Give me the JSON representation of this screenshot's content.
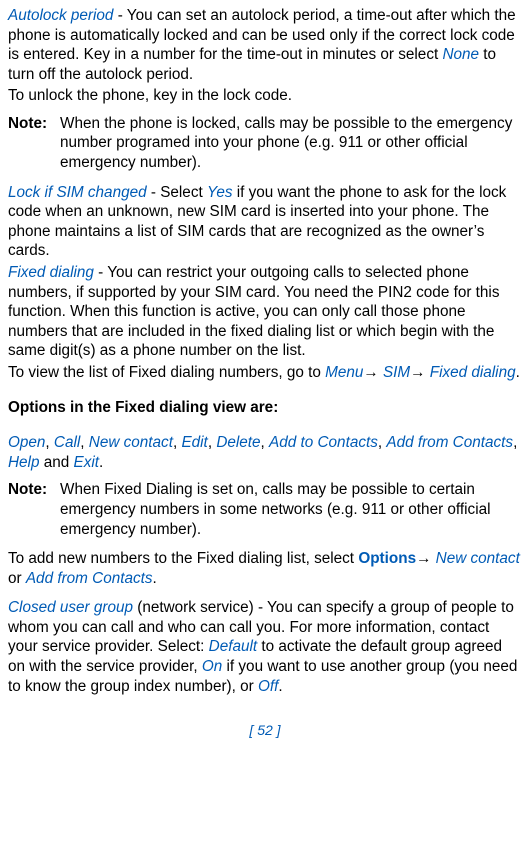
{
  "p1": {
    "t1": "Autolock period",
    "t2": " - You can set an autolock period, a time-out after which the phone is automatically locked and can be used only if the correct lock code is entered. Key in a number for the time-out in minutes or select ",
    "t3": "None",
    "t4": " to turn off the autolock period."
  },
  "p2": "To unlock the phone, key in the lock code.",
  "note1": {
    "label": "Note:",
    "body": "When the phone is locked, calls may be possible to the emergency number programed into your phone (e.g. 911 or other official emergency number)."
  },
  "p3": {
    "t1": "Lock if SIM changed",
    "t2": " - Select ",
    "t3": "Yes",
    "t4": " if you want the phone to ask for the lock code when an unknown, new SIM card is inserted into your phone. The phone maintains a list of SIM cards that are recognized as the owner’s cards."
  },
  "p4": {
    "t1": "Fixed dialing",
    "t2": " - You can restrict your outgoing calls to selected phone numbers, if supported by your SIM card. You need the PIN2 code for this function. When this function is active, you can only call those phone numbers that are included in the fixed dialing list or which begin with the same digit(s) as a phone number on the list."
  },
  "p5": {
    "t1": "To view the list of Fixed dialing numbers, go to ",
    "t2": "Menu",
    "arrow": "→",
    "t3": " SIM",
    "t4": " Fixed dialing",
    "t5": "."
  },
  "optionsHead": "Options in the Fixed dialing view are:",
  "optionsList": {
    "o1": "Open",
    "c": ", ",
    "o2": "Call",
    "o3": "New contact",
    "o4": "Edit",
    "o5": "Delete",
    "o6": "Add to Contacts",
    "o7": "Add from Contacts",
    "o8": "Help",
    "and": " and ",
    "o9": "Exit",
    "period": "."
  },
  "note2": {
    "label": "Note:",
    "body": "When Fixed Dialing is set on, calls may be possible to certain emergency numbers in some networks (e.g. 911 or other official emergency number)."
  },
  "p6": {
    "t1": "To add new numbers to the Fixed dialing list, select ",
    "t2": "Options",
    "arrow": "→",
    "t3": " New contact",
    "t4": " or ",
    "t5": "Add from Contacts",
    "t6": "."
  },
  "p7": {
    "t1": "Closed user group",
    "t2": " (network service) - You can specify a group of people to whom you can call and who can call you. For more information, contact your service provider. Select: ",
    "t3": "Default",
    "t4": " to activate the default group agreed on with the service provider, ",
    "t5": "On",
    "t6": " if you want to use another group (you need to know the group index number), or ",
    "t7": "Off",
    "t8": "."
  },
  "footer": "[ 52 ]"
}
